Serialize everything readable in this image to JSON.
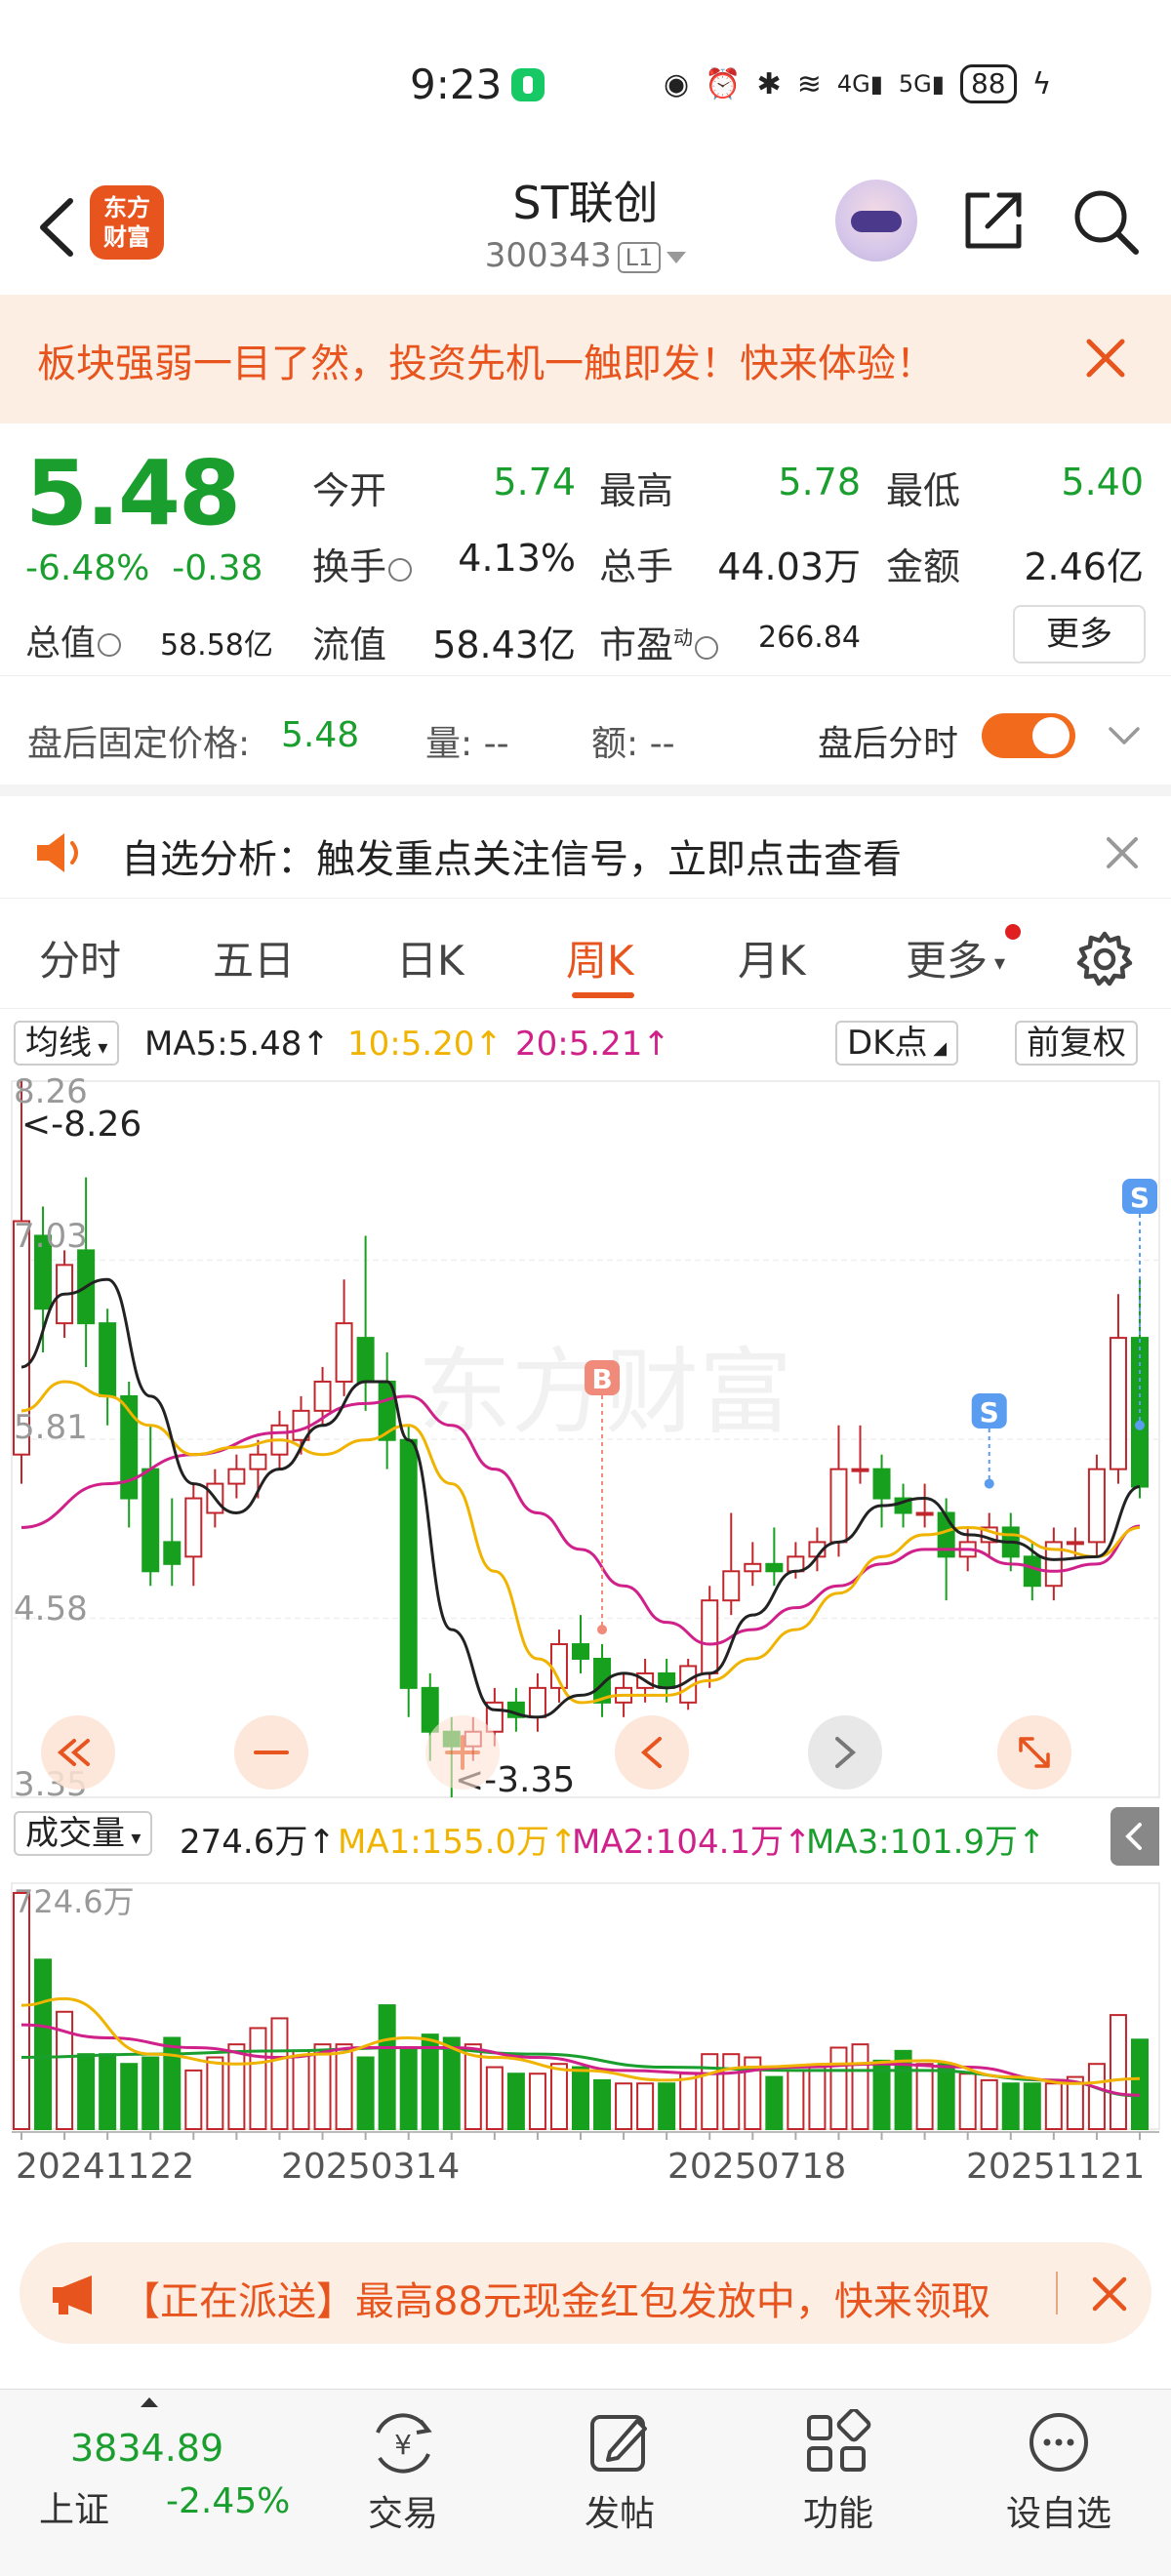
{
  "status_bar": {
    "time": "9:23",
    "battery": "88"
  },
  "header": {
    "logo_text_top": "东方",
    "logo_text_bottom": "财富",
    "name": "ST联创",
    "code": "300343",
    "level": "L1"
  },
  "promo": {
    "text": "板块强弱一目了然，投资先机一触即发！快来体验！"
  },
  "quote": {
    "price": "5.48",
    "change_pct": "-6.48%",
    "change": "-0.38",
    "open_label": "今开",
    "open": "5.74",
    "high_label": "最高",
    "high": "5.78",
    "low_label": "最低",
    "low": "5.40",
    "turnover_label": "换手",
    "turnover": "4.13%",
    "volume_label": "总手",
    "volume": "44.03万",
    "amount_label": "金额",
    "amount": "2.46亿",
    "mktcap_label": "总值",
    "mktcap": "58.58亿",
    "float_label": "流值",
    "float_cap": "58.43亿",
    "pe_label": "市盈",
    "pe_sup": "动",
    "pe": "266.84",
    "more_label": "更多"
  },
  "after_hours": {
    "label": "盘后固定价格:",
    "price": "5.48",
    "qty_label": "量: --",
    "amt_label": "额: --",
    "toggle_label": "盘后分时"
  },
  "notice": {
    "text": "自选分析：触发重点关注信号，立即点击查看"
  },
  "tabs": [
    "分时",
    "五日",
    "日K",
    "周K",
    "月K",
    "更多"
  ],
  "active_tab": "周K",
  "ma_legend": {
    "selector": "均线",
    "ma5": "MA5:5.48↑",
    "ma10": "10:5.20↑",
    "ma20": "20:5.21↑",
    "dk": "DK点",
    "adjust": "前复权",
    "colors": {
      "ma5": "#222222",
      "ma10": "#f0b400",
      "ma20": "#d0208a"
    }
  },
  "chart_labels": {
    "y_ticks": [
      "8.26",
      "7.03",
      "5.81",
      "4.58",
      "3.35"
    ],
    "max_marker": "<-8.26",
    "min_marker": "<-3.35",
    "watermark": "东方财富",
    "buy_marker": "B",
    "sell_marker": "S"
  },
  "volume_legend": {
    "selector": "成交量",
    "vol": "274.6万↑",
    "ma1": "MA1:155.0万↑",
    "ma2": "MA2:104.1万↑",
    "ma3": "MA3:101.9万↑",
    "max_label": "724.6万",
    "colors": {
      "ma1": "#f0b400",
      "ma2": "#d0208a",
      "ma3": "#1a9f2f"
    }
  },
  "date_labels": [
    "20241122",
    "20250314",
    "20250718",
    "20251121"
  ],
  "chart_data": {
    "type": "candlestick",
    "period": "weekly",
    "ylim": [
      3.35,
      8.26
    ],
    "candles": [
      [
        5.7,
        7.3,
        5.5,
        8.26
      ],
      [
        7.2,
        6.7,
        6.4,
        7.4
      ],
      [
        6.6,
        7.0,
        6.5,
        7.1
      ],
      [
        7.1,
        6.6,
        6.3,
        7.6
      ],
      [
        6.6,
        6.1,
        5.9,
        6.7
      ],
      [
        6.1,
        5.4,
        5.2,
        6.2
      ],
      [
        5.6,
        4.9,
        4.8,
        5.9
      ],
      [
        5.1,
        4.95,
        4.8,
        5.4
      ],
      [
        5.0,
        5.4,
        4.8,
        5.5
      ],
      [
        5.3,
        5.5,
        5.2,
        5.6
      ],
      [
        5.5,
        5.6,
        5.4,
        5.7
      ],
      [
        5.6,
        5.7,
        5.4,
        5.8
      ],
      [
        5.7,
        5.9,
        5.6,
        6.0
      ],
      [
        5.8,
        6.0,
        5.7,
        6.1
      ],
      [
        6.0,
        6.2,
        5.9,
        6.3
      ],
      [
        6.2,
        6.6,
        6.1,
        6.9
      ],
      [
        6.5,
        6.2,
        6.0,
        7.2
      ],
      [
        6.2,
        5.8,
        5.6,
        6.4
      ],
      [
        5.8,
        4.1,
        3.9,
        5.9
      ],
      [
        4.1,
        3.8,
        3.6,
        4.2
      ],
      [
        3.8,
        3.7,
        3.35,
        3.9
      ],
      [
        3.7,
        3.8,
        3.6,
        3.9
      ],
      [
        3.8,
        4.0,
        3.7,
        4.1
      ],
      [
        4.0,
        3.9,
        3.8,
        4.1
      ],
      [
        3.9,
        4.1,
        3.8,
        4.2
      ],
      [
        4.1,
        4.4,
        4.0,
        4.5
      ],
      [
        4.4,
        4.3,
        4.2,
        4.6
      ],
      [
        4.3,
        4.0,
        3.9,
        4.4
      ],
      [
        4.0,
        4.1,
        3.9,
        4.2
      ],
      [
        4.1,
        4.2,
        4.0,
        4.3
      ],
      [
        4.2,
        4.1,
        4.0,
        4.3
      ],
      [
        4.0,
        4.25,
        3.95,
        4.3
      ],
      [
        4.2,
        4.7,
        4.1,
        4.8
      ],
      [
        4.7,
        4.9,
        4.6,
        5.3
      ],
      [
        4.9,
        4.95,
        4.8,
        5.1
      ],
      [
        4.95,
        4.9,
        4.8,
        5.2
      ],
      [
        4.9,
        5.0,
        4.85,
        5.1
      ],
      [
        5.0,
        5.1,
        4.9,
        5.2
      ],
      [
        5.1,
        5.6,
        5.0,
        5.9
      ],
      [
        5.6,
        5.6,
        5.5,
        5.9
      ],
      [
        5.6,
        5.4,
        5.2,
        5.7
      ],
      [
        5.4,
        5.3,
        5.2,
        5.5
      ],
      [
        5.3,
        5.3,
        5.2,
        5.5
      ],
      [
        5.3,
        5.0,
        4.7,
        5.4
      ],
      [
        5.0,
        5.1,
        4.9,
        5.2
      ],
      [
        5.1,
        5.2,
        5.0,
        5.3
      ],
      [
        5.2,
        5.0,
        4.9,
        5.3
      ],
      [
        5.0,
        4.8,
        4.7,
        5.1
      ],
      [
        4.8,
        5.1,
        4.7,
        5.2
      ],
      [
        5.1,
        5.1,
        5.0,
        5.2
      ],
      [
        5.1,
        5.6,
        5.0,
        5.7
      ],
      [
        5.6,
        6.5,
        5.5,
        6.8
      ],
      [
        6.5,
        5.48,
        5.4,
        6.9
      ]
    ],
    "volume": [
      724.6,
      520,
      360,
      230,
      230,
      200,
      220,
      280,
      180,
      220,
      260,
      310,
      340,
      240,
      260,
      260,
      220,
      380,
      250,
      290,
      280,
      260,
      190,
      170,
      170,
      200,
      190,
      150,
      140,
      140,
      140,
      170,
      230,
      230,
      220,
      160,
      180,
      190,
      250,
      260,
      210,
      240,
      200,
      200,
      170,
      150,
      140,
      140,
      140,
      160,
      200,
      350,
      274.6
    ],
    "volume_max": 724.6,
    "vol_ma_keypoints": {
      "ma1": [
        [
          0,
          380
        ],
        [
          2,
          400
        ],
        [
          6,
          230
        ],
        [
          10,
          200
        ],
        [
          14,
          230
        ],
        [
          18,
          280
        ],
        [
          22,
          220
        ],
        [
          26,
          180
        ],
        [
          30,
          150
        ],
        [
          34,
          190
        ],
        [
          38,
          200
        ],
        [
          42,
          210
        ],
        [
          46,
          160
        ],
        [
          49,
          140
        ],
        [
          52,
          155
        ]
      ],
      "ma2": [
        [
          0,
          320
        ],
        [
          4,
          280
        ],
        [
          8,
          250
        ],
        [
          12,
          220
        ],
        [
          16,
          250
        ],
        [
          20,
          250
        ],
        [
          24,
          220
        ],
        [
          28,
          180
        ],
        [
          32,
          170
        ],
        [
          36,
          190
        ],
        [
          40,
          200
        ],
        [
          44,
          190
        ],
        [
          48,
          150
        ],
        [
          52,
          104
        ]
      ],
      "ma3": [
        [
          0,
          220
        ],
        [
          6,
          230
        ],
        [
          12,
          240
        ],
        [
          18,
          250
        ],
        [
          24,
          230
        ],
        [
          30,
          190
        ],
        [
          36,
          180
        ],
        [
          42,
          180
        ],
        [
          48,
          150
        ],
        [
          52,
          102
        ]
      ]
    },
    "ma_keypoints": {
      "ma5": [
        [
          0,
          6.3
        ],
        [
          2,
          6.8
        ],
        [
          4,
          6.9
        ],
        [
          6,
          6.1
        ],
        [
          8,
          5.5
        ],
        [
          10,
          5.3
        ],
        [
          12,
          5.6
        ],
        [
          14,
          5.9
        ],
        [
          16,
          6.2
        ],
        [
          17,
          6.2
        ],
        [
          18,
          5.8
        ],
        [
          20,
          4.5
        ],
        [
          22,
          3.95
        ],
        [
          24,
          3.9
        ],
        [
          26,
          4.05
        ],
        [
          28,
          4.2
        ],
        [
          30,
          4.1
        ],
        [
          32,
          4.2
        ],
        [
          34,
          4.6
        ],
        [
          36,
          4.9
        ],
        [
          38,
          5.1
        ],
        [
          40,
          5.35
        ],
        [
          42,
          5.4
        ],
        [
          44,
          5.15
        ],
        [
          46,
          5.1
        ],
        [
          48,
          4.98
        ],
        [
          50,
          5.0
        ],
        [
          52,
          5.48
        ]
      ],
      "ma10": [
        [
          0,
          6.0
        ],
        [
          2,
          6.2
        ],
        [
          4,
          6.1
        ],
        [
          6,
          5.9
        ],
        [
          8,
          5.7
        ],
        [
          10,
          5.75
        ],
        [
          12,
          5.8
        ],
        [
          14,
          5.7
        ],
        [
          16,
          5.8
        ],
        [
          18,
          5.9
        ],
        [
          20,
          5.5
        ],
        [
          22,
          4.9
        ],
        [
          24,
          4.3
        ],
        [
          26,
          4.0
        ],
        [
          28,
          4.05
        ],
        [
          30,
          4.05
        ],
        [
          32,
          4.15
        ],
        [
          34,
          4.3
        ],
        [
          36,
          4.5
        ],
        [
          38,
          4.75
        ],
        [
          40,
          5.0
        ],
        [
          42,
          5.15
        ],
        [
          44,
          5.2
        ],
        [
          46,
          5.15
        ],
        [
          48,
          5.05
        ],
        [
          50,
          5.0
        ],
        [
          52,
          5.2
        ]
      ],
      "ma20": [
        [
          0,
          5.2
        ],
        [
          4,
          5.5
        ],
        [
          8,
          5.7
        ],
        [
          12,
          5.85
        ],
        [
          16,
          6.05
        ],
        [
          18,
          6.1
        ],
        [
          20,
          5.9
        ],
        [
          22,
          5.6
        ],
        [
          24,
          5.3
        ],
        [
          26,
          5.05
        ],
        [
          28,
          4.8
        ],
        [
          30,
          4.55
        ],
        [
          32,
          4.4
        ],
        [
          34,
          4.5
        ],
        [
          36,
          4.65
        ],
        [
          38,
          4.8
        ],
        [
          40,
          4.95
        ],
        [
          42,
          5.05
        ],
        [
          44,
          5.05
        ],
        [
          46,
          4.95
        ],
        [
          48,
          4.9
        ],
        [
          50,
          4.95
        ],
        [
          52,
          5.21
        ]
      ]
    },
    "buy_index": 27,
    "sell_indices": [
      45,
      52
    ]
  },
  "red_packet": {
    "text": "【正在派送】最高88元现金红包发放中，快来领取"
  },
  "bottom_nav": {
    "index_value": "3834.89",
    "index_name": "上证",
    "index_change": "-2.45%",
    "items": [
      "交易",
      "发帖",
      "功能",
      "设自选"
    ]
  }
}
